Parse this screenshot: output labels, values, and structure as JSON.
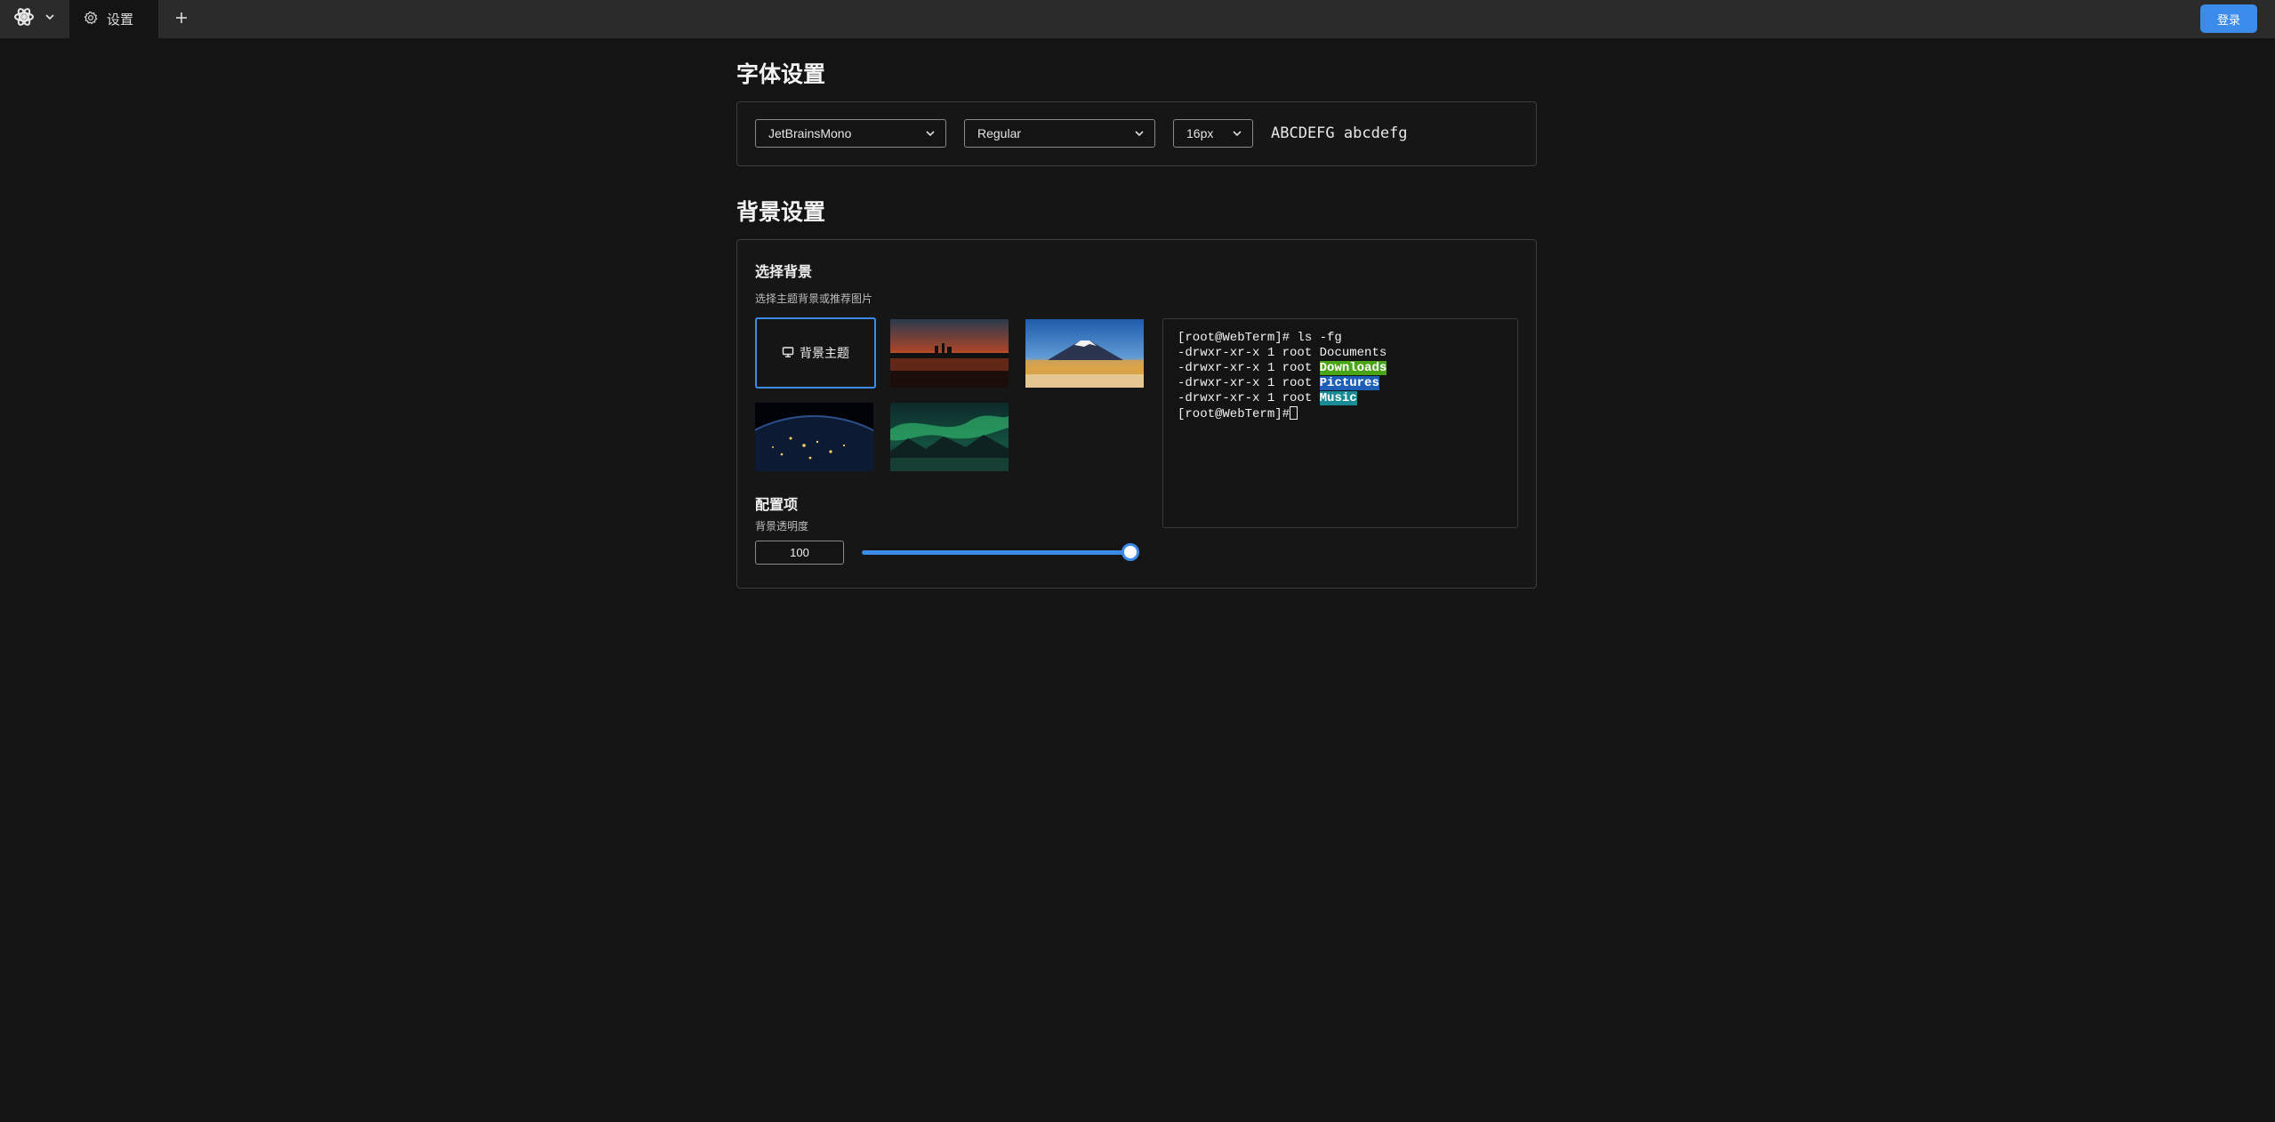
{
  "topbar": {
    "tab_label": "设置",
    "login_label": "登录"
  },
  "font_settings": {
    "title": "字体设置",
    "font_family": "JetBrainsMono",
    "font_weight": "Regular",
    "font_size": "16px",
    "preview": "ABCDEFG abcdefg"
  },
  "background_settings": {
    "title": "背景设置",
    "choose_heading": "选择背景",
    "choose_desc": "选择主题背景或推荐图片",
    "theme_option_label": "背景主题",
    "config_heading": "配置项",
    "opacity_label": "背景透明度",
    "opacity_value": "100",
    "opacity_level": 1.0
  },
  "terminal": {
    "lines": [
      {
        "prefix": "[root@WebTerm]# ls -fg",
        "name": ""
      },
      {
        "prefix": "-drwxr-xr-x 1 root ",
        "name": "Documents"
      },
      {
        "prefix": "-drwxr-xr-x 1 root ",
        "name": "Downloads"
      },
      {
        "prefix": "-drwxr-xr-x 1 root ",
        "name": "Pictures"
      },
      {
        "prefix": "-drwxr-xr-x 1 root ",
        "name": "Music"
      },
      {
        "prefix": "[root@WebTerm]#",
        "name": ""
      }
    ]
  },
  "colors": {
    "accent": "#3a8bea",
    "background": "#141414",
    "topbar": "#2b2b2b",
    "highlight_green": "#4aa516",
    "highlight_blue": "#1d5fb6",
    "highlight_teal": "#1a8a95"
  },
  "icons": [
    "app-logo-icon",
    "chevron-down-icon",
    "settings-icon",
    "plus-icon",
    "monitor-icon"
  ]
}
